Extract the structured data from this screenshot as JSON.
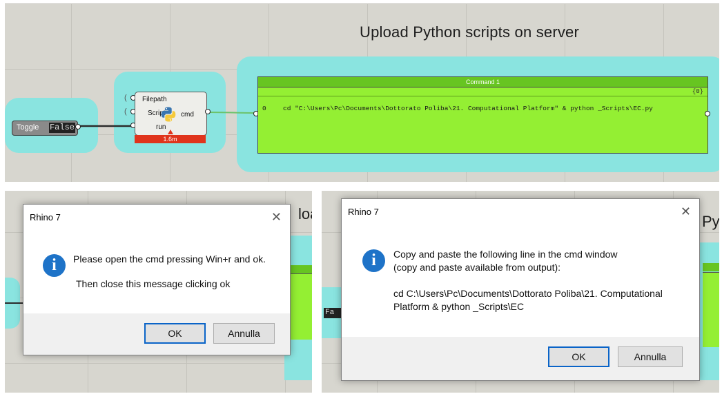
{
  "canvas": {
    "title": "Upload Python scripts on server",
    "toggle": {
      "label": "Toggle",
      "value": "False"
    },
    "python_component": {
      "inputs": [
        "Filepath",
        "Script",
        "run"
      ],
      "output": "cmd",
      "timer": "1.6m"
    },
    "panel": {
      "header": "Command 1",
      "count": "{0}",
      "rows": [
        {
          "index": "0",
          "text": "cd \"C:\\Users\\Pc\\Documents\\Dottorato Poliba\\21. Computational Platform\" & python _Scripts\\EC.py"
        }
      ]
    }
  },
  "bottom_left_background": {
    "title_fragment": "loa"
  },
  "bottom_right_background": {
    "title_fragment": "Py",
    "toggle_fragment": "Fa"
  },
  "dialog1": {
    "title": "Rhino 7",
    "close_glyph": "✕",
    "info_glyph": "i",
    "line1": "Please open the cmd pressing Win+r and ok.",
    "line2": "Then close this message clicking ok",
    "ok_label": "OK",
    "cancel_label": "Annulla"
  },
  "dialog2": {
    "title": "Rhino 7",
    "close_glyph": "✕",
    "info_glyph": "i",
    "line1": "Copy and paste the following line in the cmd window",
    "line2": "(copy and paste available from output):",
    "line3": "cd C:\\Users\\Pc\\Documents\\Dottorato Poliba\\21. Computational",
    "line4": "Platform & python _Scripts\\EC",
    "ok_label": "OK",
    "cancel_label": "Annulla"
  },
  "colors": {
    "group_cyan": "#8ae4e0",
    "panel_green": "#94ef33",
    "panel_header_green": "#67c521",
    "timer_red": "#e0341c",
    "info_blue": "#1e73c8",
    "default_button_border": "#0a64c8"
  },
  "icons": [
    "python-icon",
    "info-icon",
    "close-icon"
  ]
}
